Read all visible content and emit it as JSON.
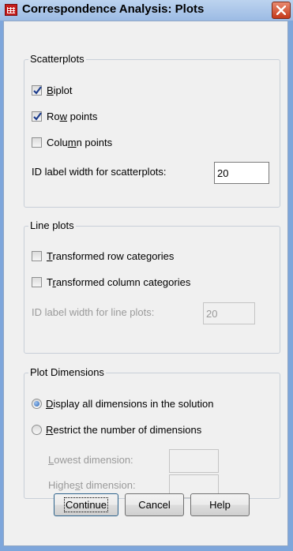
{
  "window": {
    "title": "Correspondence Analysis: Plots"
  },
  "scatterplots": {
    "legend": "Scatterplots",
    "items": [
      {
        "pre": "",
        "key": "B",
        "post": "iplot",
        "checked": true
      },
      {
        "pre": "Ro",
        "key": "w",
        "post": " points",
        "checked": true
      },
      {
        "pre": "Colu",
        "key": "m",
        "post": "n points",
        "checked": false
      }
    ],
    "id_label": "ID label width for scatterplots:",
    "id_value": "20"
  },
  "lineplots": {
    "legend": "Line plots",
    "items": [
      {
        "pre": "",
        "key": "T",
        "post": "ransformed row categories",
        "checked": false
      },
      {
        "pre": "T",
        "key": "r",
        "post": "ansformed column categories",
        "checked": false
      }
    ],
    "id_label": "ID label width for line plots:",
    "id_value": "20"
  },
  "dimensions": {
    "legend": "Plot Dimensions",
    "options": [
      {
        "pre": "",
        "key": "D",
        "post": "isplay all dimensions in the solution",
        "selected": true
      },
      {
        "pre": "",
        "key": "R",
        "post": "estrict the number of dimensions",
        "selected": false
      }
    ],
    "lowest": {
      "pre": "",
      "key": "L",
      "post": "owest dimension:"
    },
    "highest": {
      "pre": "Highe",
      "key": "s",
      "post": "t dimension:"
    }
  },
  "buttons": {
    "continue": "Continue",
    "cancel": "Cancel",
    "help": "Help"
  }
}
